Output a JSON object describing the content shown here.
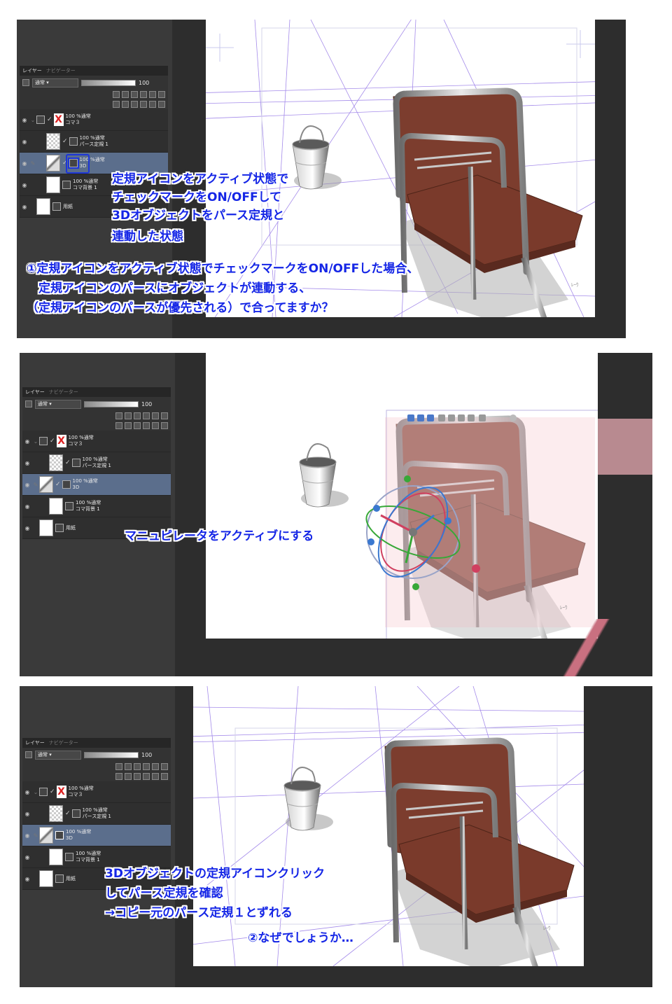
{
  "panel": {
    "tabs": [
      "レイヤー",
      "ナビゲーター"
    ],
    "blend_mode": "通常",
    "opacity": "100",
    "layers": {
      "koma3": {
        "line1": "100 %通常",
        "line2": "コマ３"
      },
      "perspective_ruler": {
        "line1": "100 %通常",
        "line2": "パース定規 1"
      },
      "object_3d": {
        "line1": "100 %通常",
        "line2": "3D"
      },
      "frame_background": {
        "line1": "100 %通常",
        "line2": "コマ背景 1"
      },
      "paper": {
        "line1": "用紙"
      }
    }
  },
  "canvas_label": "ﾚｰｳ",
  "annotations": {
    "panel1_lines": [
      "定規アイコンをアクティブ状態で",
      "チェックマークをON/OFFして",
      "3Dオブジェクトをパース定規と",
      "連動した状態"
    ],
    "panel1_question": [
      "①定規アイコンをアクティブ状態でチェックマークをON/OFFした場合、",
      "　定規アイコンのパースにオブジェクトが連動する、",
      "（定規アイコンのパースが優先される）で合ってますか？"
    ],
    "panel2_text": "マニュピレータをアクティブにする",
    "panel3_lines": [
      "3Dオブジェクトの定規アイコンクリック",
      "してパース定規を確認",
      "→コピー元のパース定規１とずれる"
    ],
    "panel3_question": "②なぜでしょうか…"
  },
  "colors": {
    "annotation_text": "#1526e6",
    "perspective_lines": "#9b7fe8",
    "chair_seat": "#7c3d2e",
    "layer_active": "#5b6e8c"
  }
}
